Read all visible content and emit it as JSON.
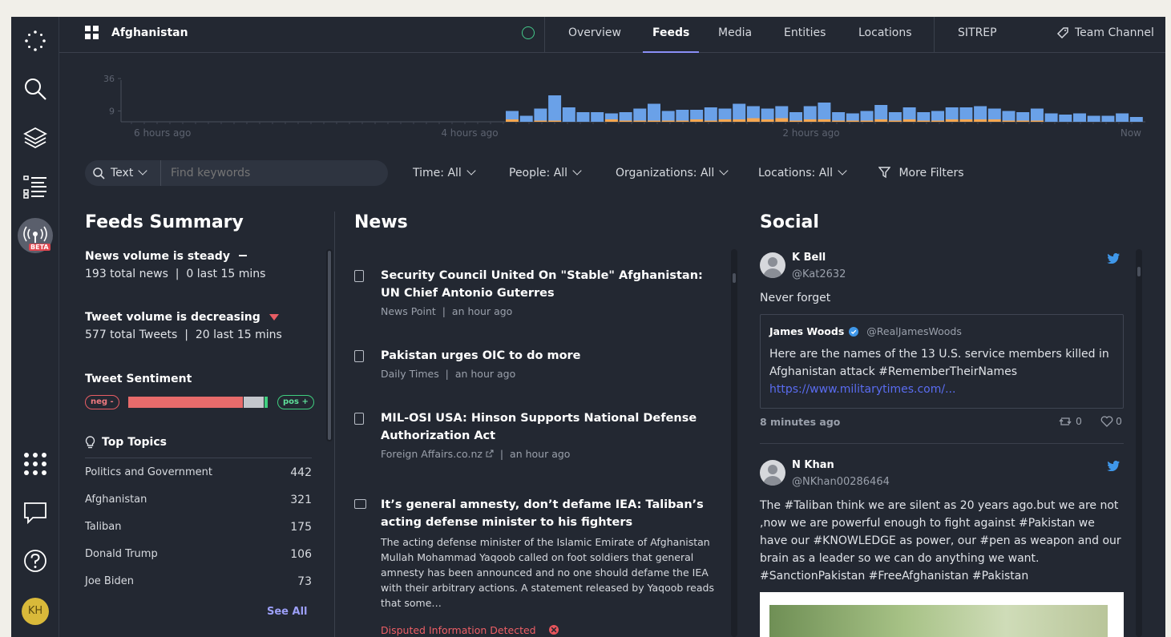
{
  "header": {
    "title": "Afghanistan",
    "tabs": [
      {
        "label": "Overview"
      },
      {
        "label": "Feeds"
      },
      {
        "label": "Media"
      },
      {
        "label": "Entities"
      },
      {
        "label": "Locations"
      }
    ],
    "sitrep": "SITREP",
    "team_channel": "Team Channel"
  },
  "rail": {
    "beta_label": "BETA",
    "user_initials": "KH"
  },
  "histogram": {
    "y_ticks": [
      "36",
      "9"
    ],
    "x_labels": [
      "6 hours ago",
      "4 hours ago",
      "2 hours ago",
      "Now"
    ],
    "colors": {
      "news": "#f5a752",
      "social": "#6aa1e8"
    },
    "bars": [
      {
        "total": 9,
        "news": 2
      },
      {
        "total": 5,
        "news": 0
      },
      {
        "total": 11,
        "news": 1
      },
      {
        "total": 22,
        "news": 1
      },
      {
        "total": 12,
        "news": 0
      },
      {
        "total": 8,
        "news": 0
      },
      {
        "total": 8,
        "news": 0
      },
      {
        "total": 7,
        "news": 2
      },
      {
        "total": 8,
        "news": 1
      },
      {
        "total": 11,
        "news": 1
      },
      {
        "total": 15,
        "news": 1
      },
      {
        "total": 9,
        "news": 1
      },
      {
        "total": 10,
        "news": 1
      },
      {
        "total": 10,
        "news": 2
      },
      {
        "total": 12,
        "news": 1
      },
      {
        "total": 11,
        "news": 2
      },
      {
        "total": 15,
        "news": 2
      },
      {
        "total": 13,
        "news": 3
      },
      {
        "total": 11,
        "news": 2
      },
      {
        "total": 13,
        "news": 3
      },
      {
        "total": 8,
        "news": 1
      },
      {
        "total": 13,
        "news": 2
      },
      {
        "total": 16,
        "news": 2
      },
      {
        "total": 8,
        "news": 1
      },
      {
        "total": 7,
        "news": 1
      },
      {
        "total": 9,
        "news": 1
      },
      {
        "total": 14,
        "news": 2
      },
      {
        "total": 8,
        "news": 1
      },
      {
        "total": 12,
        "news": 2
      },
      {
        "total": 8,
        "news": 1
      },
      {
        "total": 9,
        "news": 1
      },
      {
        "total": 12,
        "news": 2
      },
      {
        "total": 12,
        "news": 2
      },
      {
        "total": 13,
        "news": 2
      },
      {
        "total": 11,
        "news": 2
      },
      {
        "total": 9,
        "news": 1
      },
      {
        "total": 8,
        "news": 1
      },
      {
        "total": 11,
        "news": 1
      },
      {
        "total": 7,
        "news": 0
      },
      {
        "total": 6,
        "news": 0
      },
      {
        "total": 7,
        "news": 0
      },
      {
        "total": 5,
        "news": 0
      },
      {
        "total": 5,
        "news": 0
      },
      {
        "total": 7,
        "news": 0
      },
      {
        "total": 4,
        "news": 0
      }
    ]
  },
  "filters": {
    "search_mode": "Text",
    "search_placeholder": "Find keywords",
    "time": {
      "label": "Time:",
      "value": "All"
    },
    "people": {
      "label": "People:",
      "value": "All"
    },
    "organizations": {
      "label": "Organizations:",
      "value": "All"
    },
    "locations": {
      "label": "Locations:",
      "value": "All"
    },
    "more": "More Filters"
  },
  "summary": {
    "title": "Feeds Summary",
    "news_volume": {
      "heading": "News volume is steady",
      "total": "193 total news",
      "recent": "0 last 15 mins"
    },
    "tweet_volume": {
      "heading": "Tweet volume is decreasing",
      "total": "577 total Tweets",
      "recent": "20 last 15 mins"
    },
    "sentiment": {
      "heading": "Tweet Sentiment",
      "neg_label": "neg -",
      "pos_label": "pos +",
      "neg_fraction": 0.82,
      "neutral_fraction": 0.15,
      "pos_fraction": 0.03
    },
    "topics_heading": "Top Topics",
    "topics": [
      {
        "name": "Politics and Government",
        "count": "442"
      },
      {
        "name": "Afghanistan",
        "count": "321"
      },
      {
        "name": "Taliban",
        "count": "175"
      },
      {
        "name": "Donald Trump",
        "count": "106"
      },
      {
        "name": "Joe Biden",
        "count": "73"
      }
    ],
    "see_all": "See All"
  },
  "news": {
    "title": "News",
    "items": [
      {
        "title": "Security Council United On \"Stable\" Afghanistan: UN Chief Antonio Guterres",
        "source": "News Point",
        "time": "an hour ago"
      },
      {
        "title": "Pakistan urges OIC to do more",
        "source": "Daily Times",
        "time": "an hour ago"
      },
      {
        "title": "MIL-OSI USA: Hinson Supports National Defense Authorization Act",
        "source": "Foreign Affairs.co.nz",
        "time": "an hour ago"
      },
      {
        "title": "It’s general amnesty, don’t defame IEA: Taliban’s acting defense minister to his fighters",
        "body": "The acting defense minister of the Islamic Emirate of Afghanistan Mullah Mohammad Yaqoob called on foot soldiers that general amnesty has been announced and no one should defame the IEA with their arbitrary actions. A statement released by Yaqoob reads that some…",
        "flag": "Disputed Information Detected"
      }
    ]
  },
  "social": {
    "title": "Social",
    "tweets": [
      {
        "name": "K Bell",
        "handle": "@Kat2632",
        "text": "Never forget",
        "time": "8 minutes ago",
        "retweets": "0",
        "likes": "0",
        "quote": {
          "name": "James Woods",
          "handle": "@RealJamesWoods",
          "text": "Here are the names of the 13 U.S. service members killed in Afghanistan attack #RememberTheirNames",
          "link": "https://www.militarytimes.com/..."
        }
      },
      {
        "name": "N Khan",
        "handle": "@NKhan00286464",
        "text": "The #Taliban think we are silent as 20 years ago.but we are not ,now we are powerful enough to fight against #Pakistan we have our #KNOWLEDGE as power, our #pen as weapon and our brain as a leader so we can do anything we want. #SanctionPakistan #FreeAfghanistan #Pakistan"
      }
    ]
  }
}
